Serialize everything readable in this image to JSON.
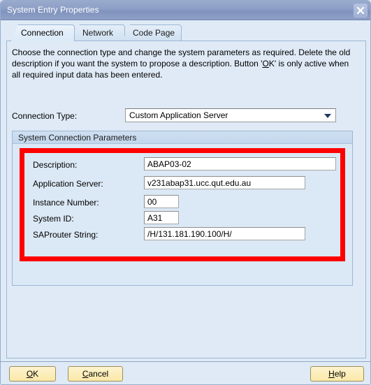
{
  "window": {
    "title": "System Entry Properties",
    "close_icon": "close-icon"
  },
  "tabs": [
    {
      "label": "Connection",
      "active": true
    },
    {
      "label": "Network",
      "active": false
    },
    {
      "label": "Code Page",
      "active": false
    }
  ],
  "intro": {
    "part1": "Choose the connection type and change the system parameters as required. Delete the old description if you want the system to propose a description. Button '",
    "mnemonic": "O",
    "part2": "K' is only active when all required input data has been entered."
  },
  "connection_type": {
    "label": "Connection Type:",
    "value": "Custom Application Server",
    "arrow_icon": "chevron-down-icon"
  },
  "group": {
    "title": "System Connection Parameters",
    "fields": [
      {
        "label": "Description:",
        "value": "ABAP03-02"
      },
      {
        "label": "Application Server:",
        "value": "v231abap31.ucc.qut.edu.au"
      },
      {
        "label": "Instance Number:",
        "value": "00"
      },
      {
        "label": "System ID:",
        "value": "A31"
      },
      {
        "label": "SAProuter String:",
        "value": "/H/131.181.190.100/H/"
      }
    ]
  },
  "annotation": {
    "color": "#fe0000"
  },
  "buttons": {
    "ok": {
      "mnemonic": "O",
      "rest": "K"
    },
    "cancel": {
      "mnemonic": "C",
      "rest": "ancel"
    },
    "help": {
      "mnemonic": "H",
      "rest": "elp"
    }
  }
}
